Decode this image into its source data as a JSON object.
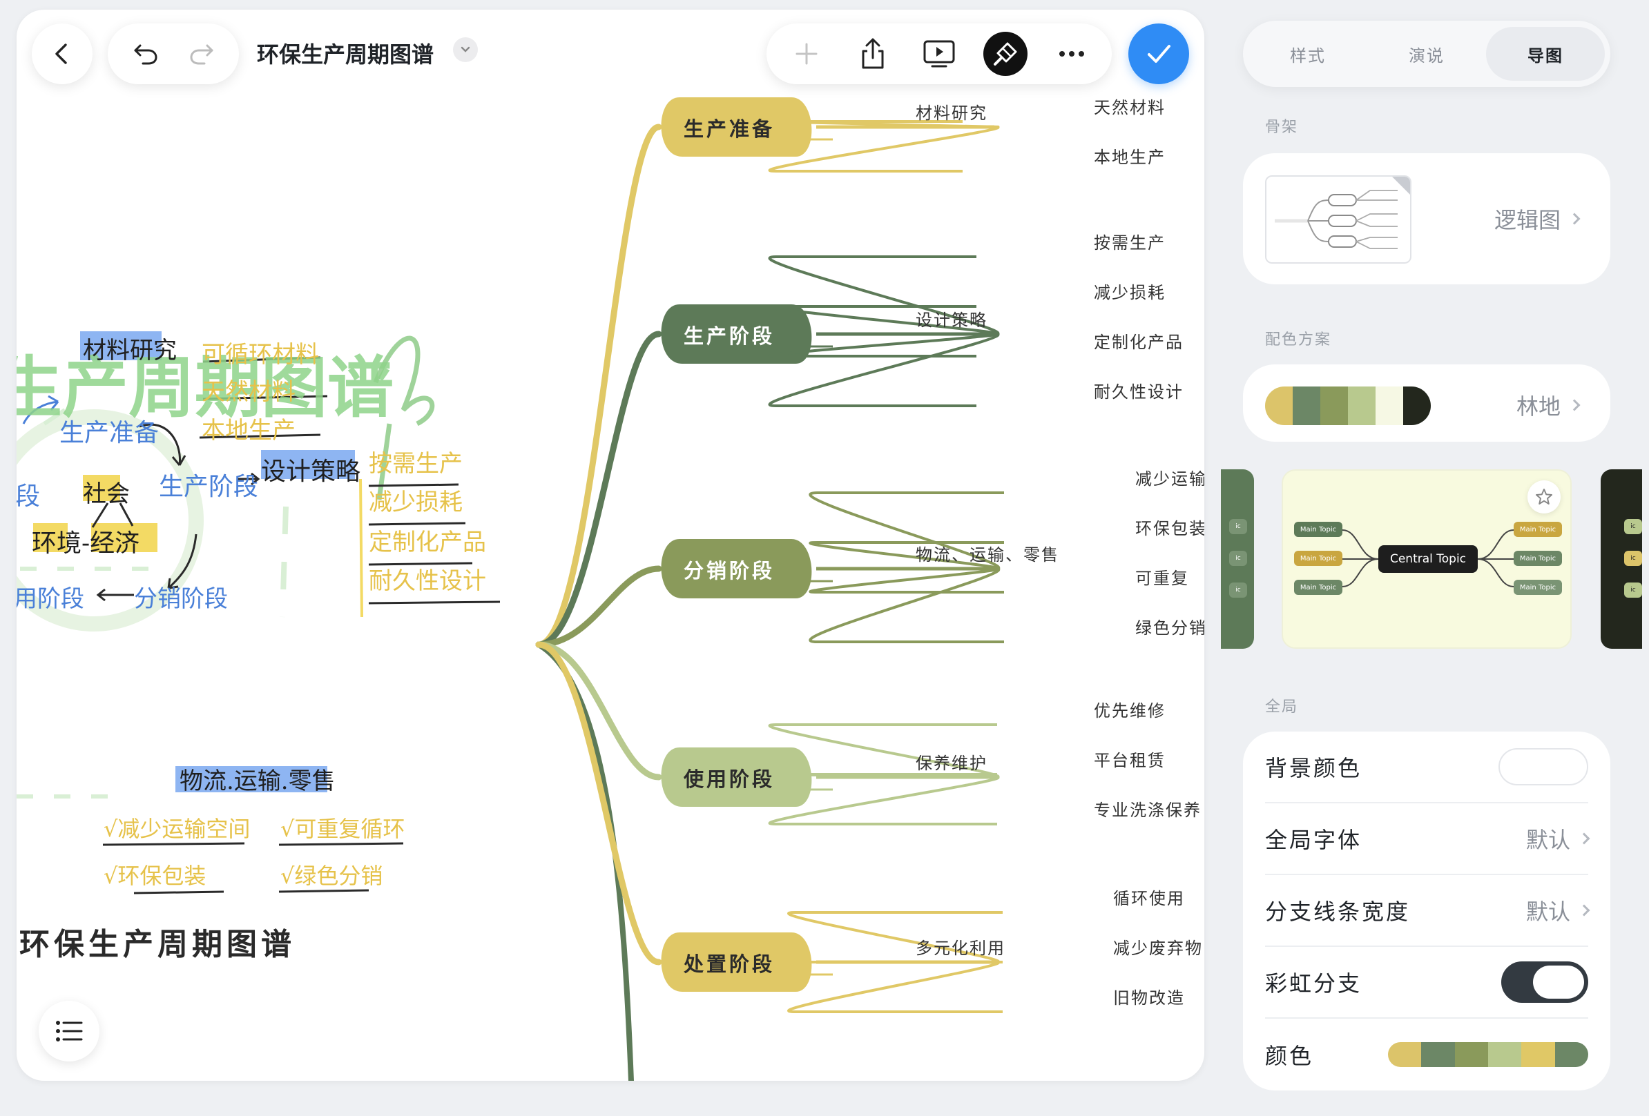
{
  "toolbar": {
    "doc_title": "环保生产周期图谱"
  },
  "mindmap": {
    "branches": [
      {
        "label": "生产准备",
        "color": "#e0c866",
        "sub": "材料研究",
        "leaves": [
          "天然材料",
          "本地生产"
        ]
      },
      {
        "label": "生产阶段",
        "color": "#5d7a58",
        "sub": "设计策略",
        "leaves": [
          "按需生产",
          "减少损耗",
          "定制化产品",
          "耐久性设计"
        ]
      },
      {
        "label": "分销阶段",
        "color": "#8a9a5b",
        "sub": "物流、运输、零售",
        "leaves": [
          "减少运输",
          "环保包装",
          "可重复",
          "绿色分销"
        ]
      },
      {
        "label": "使用阶段",
        "color": "#b8c98e",
        "sub": "保养维护",
        "leaves": [
          "优先维修",
          "平台租赁",
          "专业洗涤保养"
        ]
      },
      {
        "label": "处置阶段",
        "color": "#e0c866",
        "sub": "多元化利用",
        "leaves": [
          "循环使用",
          "减少废弃物",
          "旧物改造"
        ]
      }
    ]
  },
  "sketch": {
    "title": "环保生产周期图谱",
    "heading": "生产周期图谱",
    "material_research": "材料研究",
    "recyclable": "可循环材料",
    "natural": "天然材料",
    "local": "本地生产",
    "prep": "生产准备",
    "society": "社会",
    "env_econ": "环境-经济",
    "stage_left": "段",
    "production": "生产阶段",
    "design": "设计策略",
    "use": "用阶段",
    "distribution": "分销阶段",
    "on_demand": "按需生产",
    "less_loss": "减少损耗",
    "custom": "定制化产品",
    "durable": "耐久性设计",
    "logistics": "物流.运输.零售",
    "less_transport": "√减少运输空间",
    "reusable": "√可重复循环",
    "eco_pack": "√环保包装",
    "green_dist": "√绿色分销"
  },
  "panel": {
    "tabs": [
      "样式",
      "演说",
      "导图"
    ],
    "active_tab": "导图",
    "skeleton_label": "骨架",
    "skeleton_value": "逻辑图",
    "palette_label": "配色方案",
    "palette_value": "林地",
    "palette_colors": [
      "#dcc46a",
      "#6c8766",
      "#8a9a5b",
      "#b8c98e",
      "#f6f8e4",
      "#23271d"
    ],
    "theme_preview": {
      "central": "Central Topic",
      "main": "Main Topic",
      "side": "ic"
    },
    "global_label": "全局",
    "global_rows": {
      "bg_color": "背景颜色",
      "font": "全局字体",
      "font_value": "默认",
      "branch_width": "分支线条宽度",
      "branch_width_value": "默认",
      "rainbow": "彩虹分支",
      "color": "颜色"
    },
    "rainbow_on": true,
    "branch_colors": [
      "#dcc46a",
      "#6c8766",
      "#8a9a5b",
      "#b8c98e",
      "#e0c866",
      "#6c8766"
    ]
  }
}
